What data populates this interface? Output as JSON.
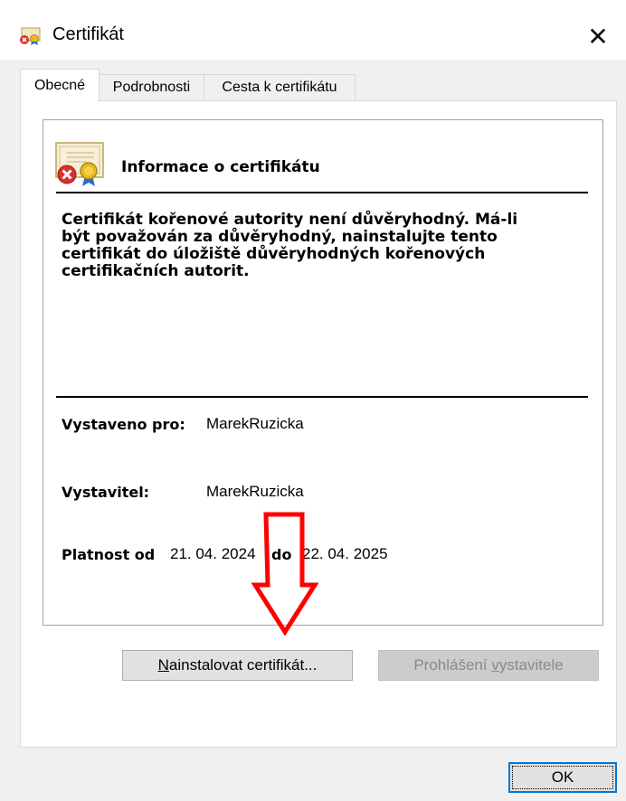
{
  "window": {
    "title": "Certifikát",
    "icons": {
      "title": "certificate-small-icon",
      "close": "close-icon"
    },
    "close_glyph": "✕"
  },
  "tabs": [
    {
      "label": "Obecné",
      "active": true
    },
    {
      "label": "Podrobnosti",
      "active": false
    },
    {
      "label": "Cesta k certifikátu",
      "active": false
    }
  ],
  "info": {
    "icon": "certificate-untrusted-icon",
    "title": "Informace o certifikátu",
    "warning_lines": [
      "Certifikát kořenové autority není důvěryhodný. Má-li",
      "být považován za důvěryhodný, nainstalujte tento",
      "certifikát do úložiště důvěryhodných kořenových",
      "certifikačních autorit."
    ],
    "issued_to_label": "Vystaveno pro:",
    "issued_to_value": "MarekRuzicka",
    "issuer_label": "Vystavitel:",
    "issuer_value": "MarekRuzicka",
    "validity_from_label": "Platnost od",
    "validity_from_value": "21. 04. 2024",
    "validity_to_label": "do",
    "validity_to_value": "22. 04. 2025"
  },
  "buttons": {
    "install": {
      "mnemonic": "N",
      "rest": "ainstalovat certifikát..."
    },
    "issuer_statement": {
      "before": "Prohlášení ",
      "mnemonic": "v",
      "rest": "ystavitele",
      "enabled": false
    },
    "ok": "OK"
  },
  "annotation": {
    "type": "red-arrow-down",
    "color": "#ff0000"
  },
  "colors": {
    "accent": "#0078d7",
    "arrow": "#ff0000",
    "error": "#d9312b",
    "seal": "#e8b920"
  }
}
